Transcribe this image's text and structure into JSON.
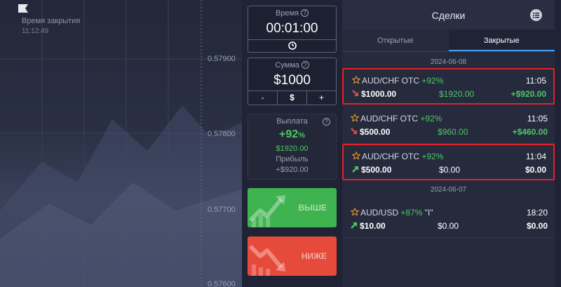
{
  "chart": {
    "close_time_label": "Время закрытия",
    "close_time_value": "11:12:49",
    "price_ticks": [
      "0.57900",
      "0.57800",
      "0.57700",
      "0.57600"
    ]
  },
  "controls": {
    "time": {
      "label": "Время",
      "value": "00:01:00"
    },
    "amount": {
      "label": "Сумма",
      "value": "$1000",
      "minus": "-",
      "currency": "$",
      "plus": "+"
    },
    "payout": {
      "label": "Выплата",
      "percent": "+92",
      "percent_sign": "%",
      "amount": "$1920.00",
      "profit_label": "Прибыль",
      "profit_value": "+$920.00"
    },
    "up_label": "ВЫШЕ",
    "down_label": "НИЖЕ"
  },
  "deals": {
    "title": "Сделки",
    "tabs": [
      "Открытые",
      "Закрытые"
    ],
    "active_tab": "Закрытые",
    "groups": [
      {
        "date": "2024-06-08",
        "items": [
          {
            "pair": "AUD/CHF OTC",
            "percent": "+92%",
            "time": "11:05",
            "direction": "down",
            "stake": "$1000.00",
            "payout": "$1920.00",
            "profit": "+$920.00",
            "highlight": true,
            "win": true
          },
          {
            "pair": "AUD/CHF OTC",
            "percent": "+92%",
            "time": "11:05",
            "direction": "down",
            "stake": "$500.00",
            "payout": "$960.00",
            "profit": "+$460.00",
            "highlight": false,
            "win": true
          },
          {
            "pair": "AUD/CHF OTC",
            "percent": "+92%",
            "time": "11:04",
            "direction": "up",
            "stake": "$500.00",
            "payout": "$0.00",
            "profit": "$0.00",
            "highlight": true,
            "win": false
          }
        ]
      },
      {
        "date": "2024-06-07",
        "items": [
          {
            "pair": "AUD/USD",
            "percent": "+87%",
            "suffix": " \"I\"",
            "time": "18:20",
            "direction": "up",
            "stake": "$10.00",
            "payout": "$0.00",
            "profit": "$0.00",
            "highlight": false,
            "win": false
          }
        ]
      }
    ]
  },
  "colors": {
    "green": "#4cc866",
    "red": "#e64a3b",
    "highlight_border": "#e22228",
    "tab_underline": "#4a9ef2"
  }
}
